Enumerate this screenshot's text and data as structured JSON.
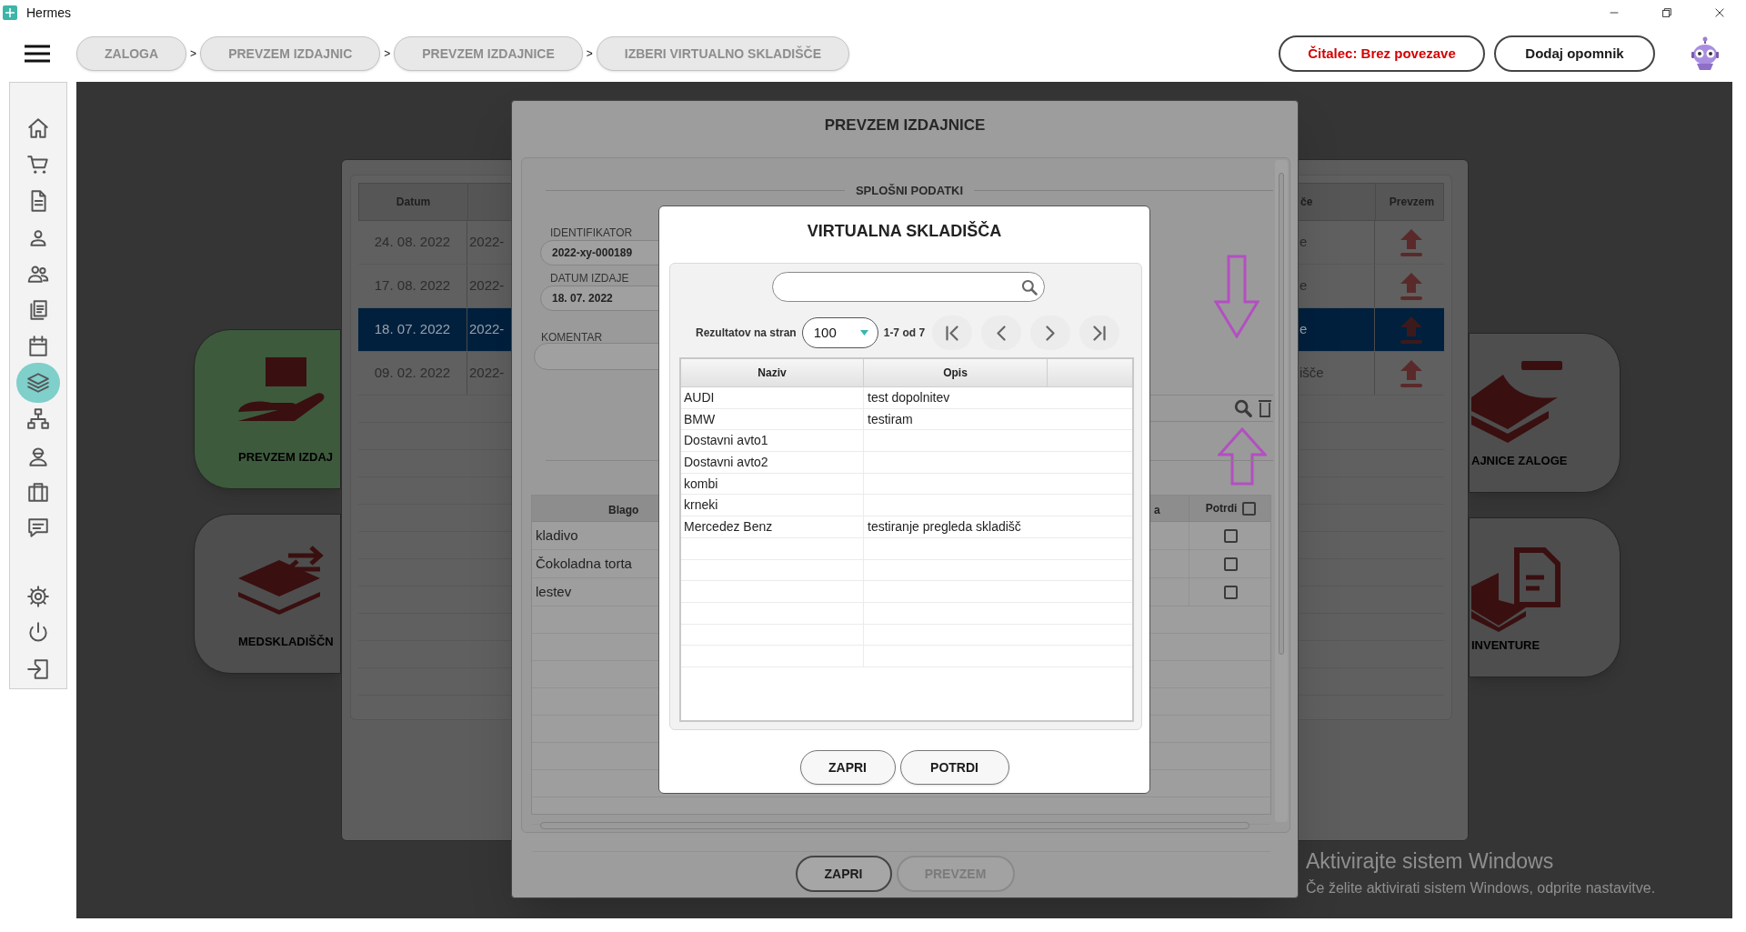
{
  "window": {
    "title": "Hermes"
  },
  "breadcrumbs": [
    {
      "label": "ZALOGA"
    },
    {
      "separator": ">",
      "label": "PREVZEM IZDAJNIC"
    },
    {
      "separator": ">",
      "label": "PREVZEM IZDAJNICE"
    },
    {
      "separator": ">",
      "label": "IZBERI VIRTUALNO SKLADIŠČE"
    }
  ],
  "header_buttons": [
    {
      "label": "Čitalec: Brez povezave",
      "kind": "warning"
    },
    {
      "label": "Dodaj opomnik",
      "kind": "normal"
    }
  ],
  "sidebar": {
    "items": [
      {
        "selected": false
      },
      {
        "selected": false
      },
      {
        "selected": false
      },
      {
        "selected": false
      },
      {
        "selected": false
      },
      {
        "selected": false
      },
      {
        "selected": false
      },
      {
        "selected": true
      },
      {
        "selected": false
      },
      {
        "selected": false
      },
      {
        "selected": false
      },
      {
        "selected": false
      }
    ],
    "bottom_items": [
      {
        "selected": false
      },
      {
        "selected": false
      },
      {
        "selected": false
      }
    ]
  },
  "tiles": [
    {
      "label": "PREVZEM IZDAJ",
      "selected": true
    },
    {
      "label": "MEDSKLADIŠČN",
      "selected": false
    },
    {
      "label": "AJNICE ZALOGE",
      "selected": false
    },
    {
      "label": "INVENTURE",
      "selected": false
    }
  ],
  "issues_list": {
    "columns": [
      {
        "label": "Datum"
      },
      {
        "label": "če"
      },
      {
        "label": "Prevzem"
      }
    ],
    "rows": [
      {
        "date": "24. 08. 2022",
        "column_2": "2022-",
        "column_3": "e",
        "selected": false
      },
      {
        "date": "17. 08. 2022",
        "column_2": "2022-",
        "column_3": "e",
        "selected": false
      },
      {
        "date": "18. 07. 2022",
        "column_2": "2022-",
        "column_3": "e",
        "selected": true
      },
      {
        "date": "09. 02. 2022",
        "column_2": "2022-",
        "column_3": "išče",
        "selected": false
      }
    ]
  },
  "issue_dialog": {
    "title": "PREVZEM IZDAJNICE",
    "section": "SPLOŠNI PODATKI",
    "fields": [
      {
        "label": "IDENTIFIKATOR",
        "value": "2022-xy-000189"
      },
      {
        "label": "DATUM IZDAJE",
        "value": "18. 07. 2022"
      },
      {
        "label": "KOMENTAR"
      }
    ],
    "items_table": {
      "columns": [
        {
          "label": "Blago"
        },
        {
          "label": "a"
        },
        {
          "label": "Potrdi"
        }
      ],
      "all_checked": false,
      "rows": [
        {
          "name": "kladivo",
          "checked": false
        },
        {
          "name": "Čokoladna torta",
          "checked": false
        },
        {
          "name": "lestev",
          "checked": false
        }
      ]
    },
    "buttons": [
      {
        "label": "ZAPRI",
        "disabled": false
      },
      {
        "label": "PREVZEM",
        "disabled": true
      }
    ]
  },
  "warehouse_dialog": {
    "title": "VIRTUALNA SKLADIŠČA",
    "page_size_label": "Rezultatov na stran",
    "page_size": "100",
    "range": "1-7 od 7",
    "columns": [
      {
        "label": "Naziv"
      },
      {
        "label": "Opis"
      }
    ],
    "rows": [
      {
        "name": "AUDI",
        "description": "test dopolnitev"
      },
      {
        "name": "BMW",
        "description": "testiram"
      },
      {
        "name": "Dostavni avto1"
      },
      {
        "name": "Dostavni avto2"
      },
      {
        "name": "kombi"
      },
      {
        "name": "krneki"
      },
      {
        "name": "Mercedez Benz",
        "description": "testiranje pregleda skladišč"
      }
    ],
    "buttons": [
      {
        "label": "ZAPRI"
      },
      {
        "label": "POTRDI"
      }
    ]
  },
  "activation_notice": {
    "title": "Aktivirajte sistem Windows",
    "text": "Če želite aktivirati sistem Windows, odprite nastavitve."
  }
}
